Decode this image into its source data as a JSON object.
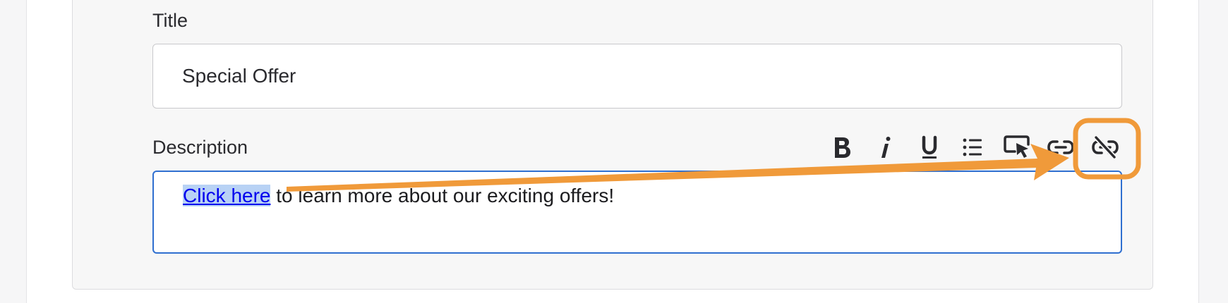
{
  "form": {
    "title_label": "Title",
    "title_value": "Special Offer",
    "description_label": "Description",
    "description": {
      "link_text": "Click here",
      "rest_text": " to learn more about our exciting offers!"
    }
  },
  "toolbar": {
    "buttons": [
      {
        "name": "bold",
        "icon": "bold-icon"
      },
      {
        "name": "italic",
        "icon": "italic-icon"
      },
      {
        "name": "underline",
        "icon": "underline-icon"
      },
      {
        "name": "bullet-list",
        "icon": "bullet-list-icon"
      },
      {
        "name": "button-insert",
        "icon": "cursor-click-icon"
      },
      {
        "name": "link",
        "icon": "link-icon"
      },
      {
        "name": "unlink",
        "icon": "unlink-icon",
        "highlighted": true
      }
    ]
  },
  "colors": {
    "accent_annotation": "#f09a3a",
    "focus_border": "#2f6fd0",
    "link": "#0000ee",
    "selection": "#b8d2f5"
  }
}
